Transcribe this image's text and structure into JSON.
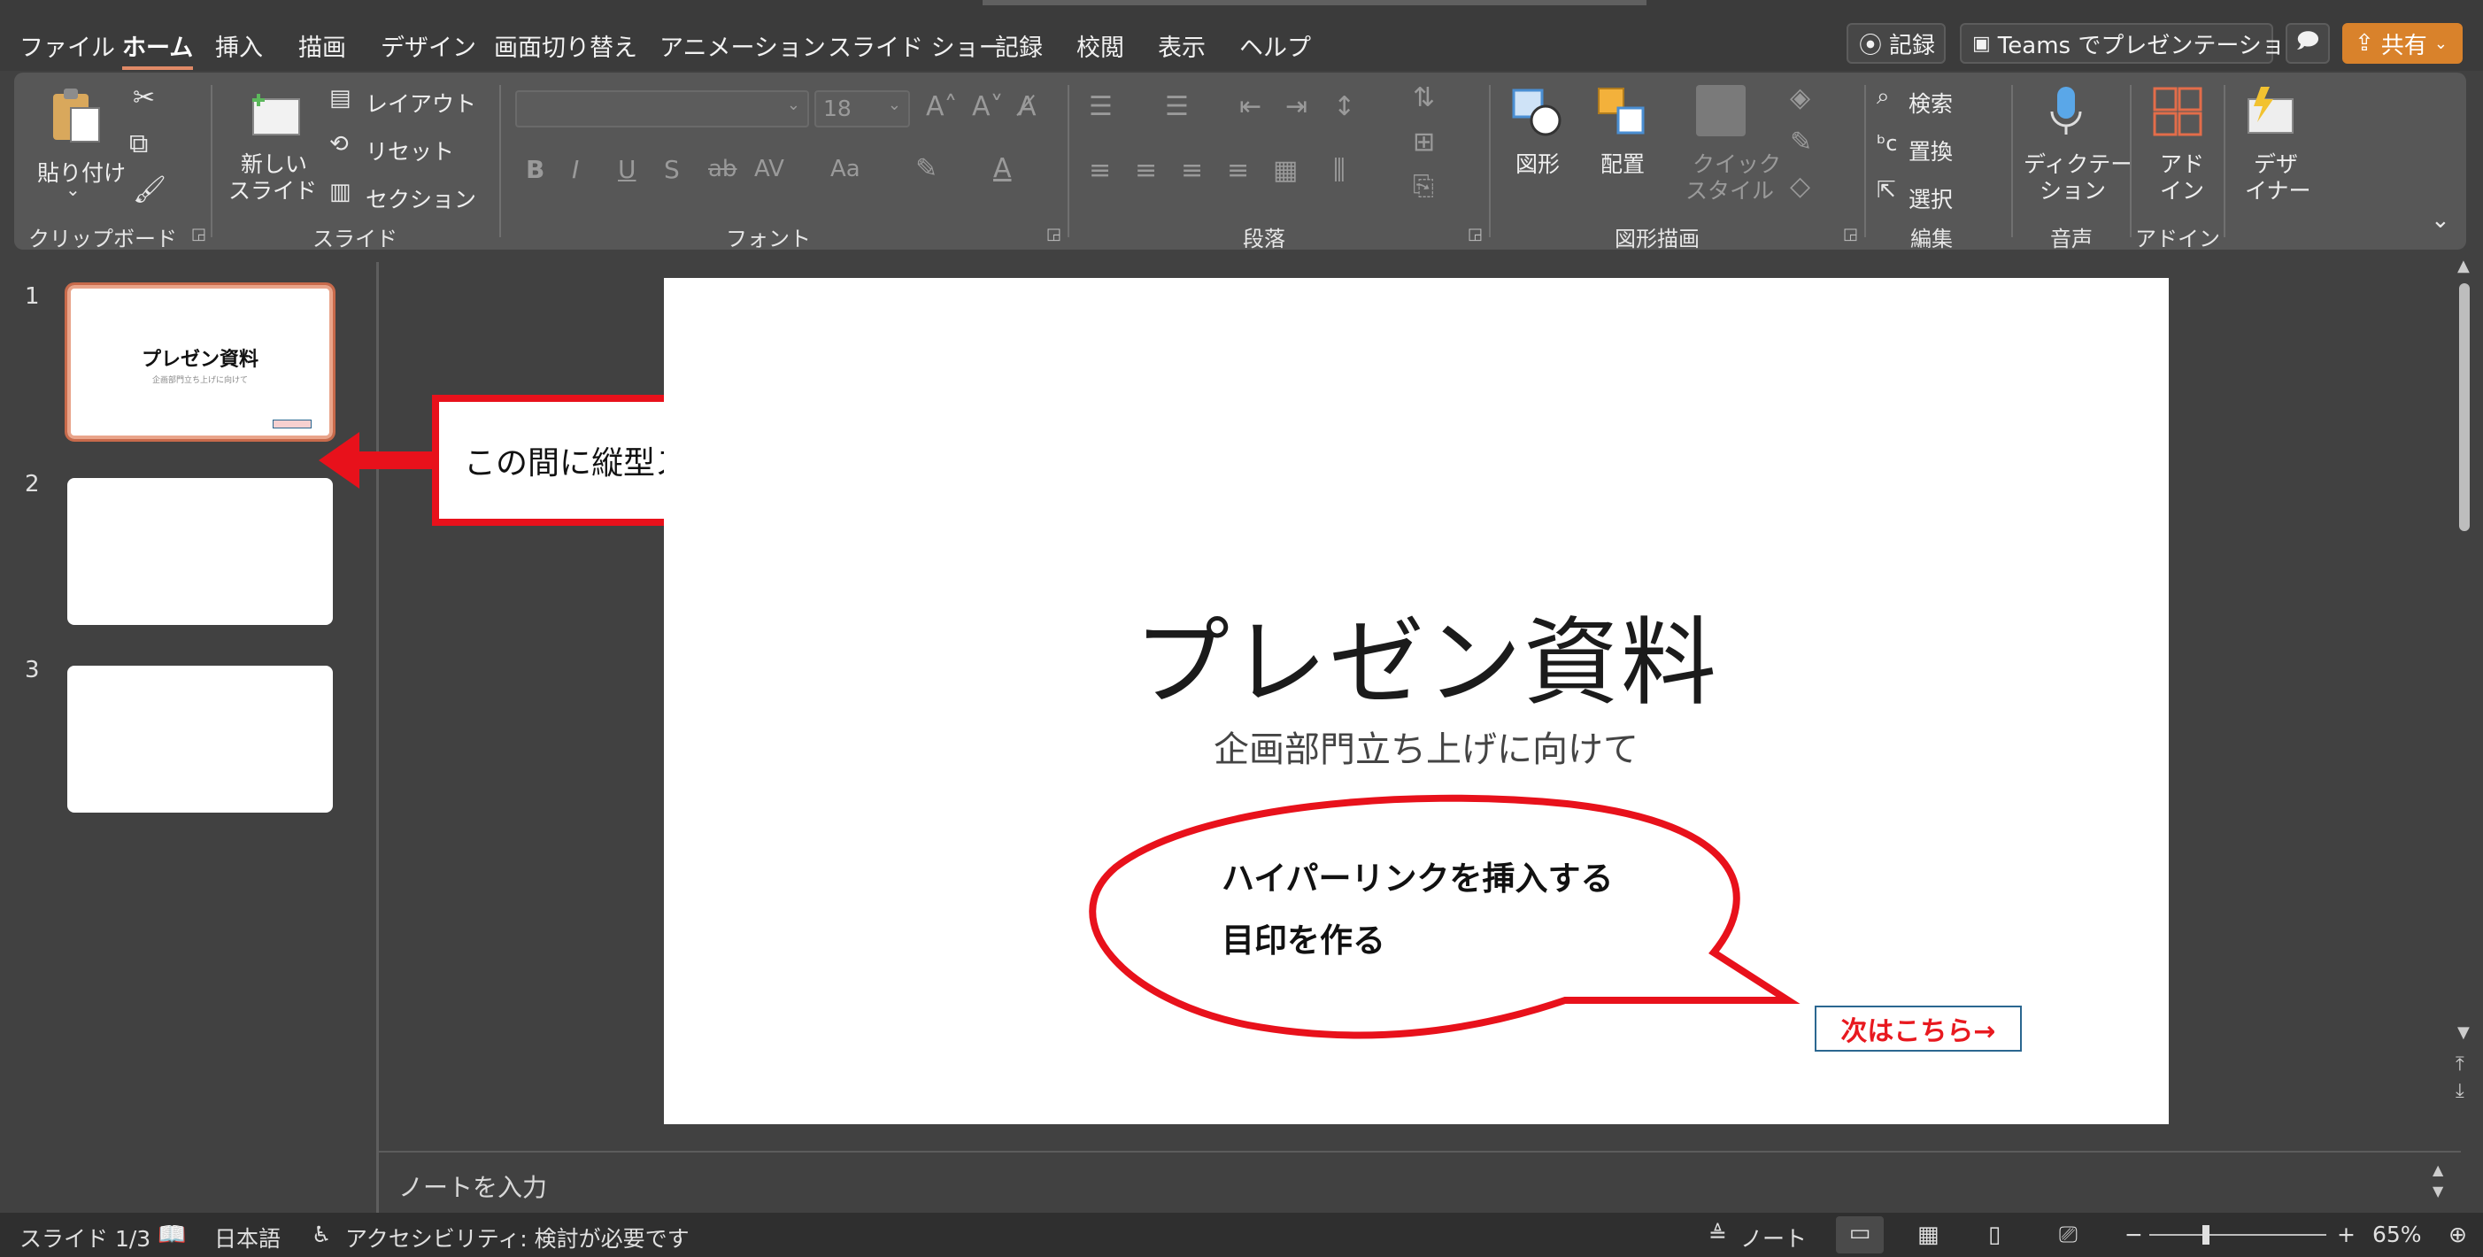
{
  "menu": {
    "tabs": [
      "ファイル",
      "ホーム",
      "挿入",
      "描画",
      "デザイン",
      "画面切り替え",
      "アニメーション",
      "スライド ショー",
      "記録",
      "校閲",
      "表示",
      "ヘルプ"
    ],
    "active_tab": "ホーム",
    "record_button": "記録",
    "teams_button": "Teams でプレゼンテーション",
    "share_button": "共有"
  },
  "ribbon": {
    "clipboard": {
      "label": "クリップボード",
      "paste": "貼り付け"
    },
    "slides": {
      "label": "スライド",
      "new_slide": "新しい\nスライド",
      "new_slide_l1": "新しい",
      "new_slide_l2": "スライド",
      "layout": "レイアウト",
      "reset": "リセット",
      "section": "セクション"
    },
    "font": {
      "label": "フォント",
      "size": "18"
    },
    "paragraph": {
      "label": "段落"
    },
    "drawing": {
      "label": "図形描画",
      "shapes": "図形",
      "arrange": "配置",
      "quick_style_l1": "クイック",
      "quick_style_l2": "スタイル"
    },
    "editing": {
      "label": "編集",
      "find": "検索",
      "replace": "置換",
      "select": "選択"
    },
    "voice": {
      "label": "音声",
      "dictate_l1": "ディクテー",
      "dictate_l2": "ション"
    },
    "addins": {
      "label": "アドイン",
      "addin_l1": "アド",
      "addin_l2": "イン"
    },
    "designer": {
      "l1": "デザ",
      "l2": "イナー"
    }
  },
  "thumbnails": {
    "numbers": [
      "1",
      "2",
      "3"
    ],
    "thumb1_title": "プレゼン資料",
    "thumb1_subtitle": "企画部門立ち上げに向けて"
  },
  "slide": {
    "title": "プレゼン資料",
    "subtitle": "企画部門立ち上げに向けて",
    "link_text": "次はこちら→"
  },
  "annotations": {
    "callout_box": "この間に縦型スライドを入れる",
    "bubble_line1": "ハイパーリンクを挿入する",
    "bubble_line2": "目印を作る",
    "accent_color": "#e8111b"
  },
  "notes": {
    "placeholder": "ノートを入力"
  },
  "statusbar": {
    "slide_pos": "スライド 1/3",
    "language": "日本語",
    "accessibility": "アクセシビリティ: 検討が必要です",
    "notes": "ノート",
    "zoom": "65%"
  }
}
